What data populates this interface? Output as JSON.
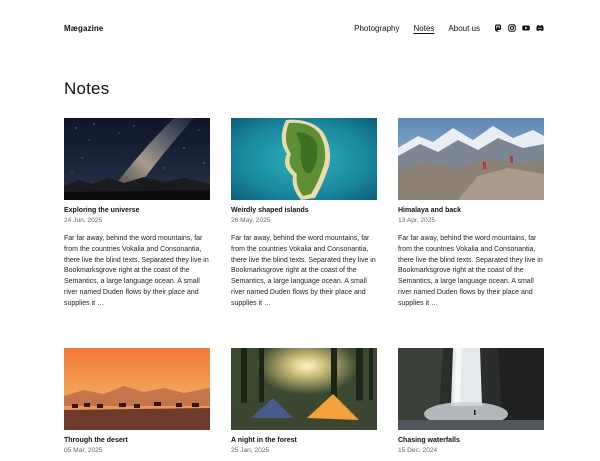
{
  "site": {
    "logo": "Mægazine"
  },
  "nav": {
    "items": [
      {
        "label": "Photography"
      },
      {
        "label": "Notes"
      },
      {
        "label": "About us"
      }
    ],
    "social_icons": [
      "mastodon-icon",
      "instagram-icon",
      "youtube-icon",
      "discord-icon"
    ]
  },
  "page": {
    "title": "Notes"
  },
  "posts": [
    {
      "title": "Exploring the universe",
      "date": "24 Jun, 2025",
      "excerpt": "Far far away, behind the word mountains, far from the countries Vokalia and Consonantia, there live the blind texts. Separated they live in Bookmarksgrove right at the coast of the Semantics, a large language ocean. A small river named Duden flows by their place and supplies it …",
      "image": "milky-way-night-sky"
    },
    {
      "title": "Weirdly shaped islands",
      "date": "26 May, 2025",
      "excerpt": "Far far away, behind the word mountains, far from the countries Vokalia and Consonantia, there live the blind texts. Separated they live in Bookmarksgrove right at the coast of the Semantics, a large language ocean. A small river named Duden flows by their place and supplies it …",
      "image": "aerial-island"
    },
    {
      "title": "Himalaya and back",
      "date": "13 Apr, 2025",
      "excerpt": "Far far away, behind the word mountains, far from the countries Vokalia and Consonantia, there live the blind texts. Separated they live in Bookmarksgrove right at the coast of the Semantics, a large language ocean. A small river named Duden flows by their place and supplies it …",
      "image": "himalaya-mountains"
    },
    {
      "title": "Through the desert",
      "date": "05 Mar, 2025",
      "excerpt": "",
      "image": "desert-camels-sunset"
    },
    {
      "title": "A night in the forest",
      "date": "25 Jan, 2025",
      "excerpt": "",
      "image": "forest-tents"
    },
    {
      "title": "Chasing waterfalls",
      "date": "15 Dec, 2024",
      "excerpt": "",
      "image": "waterfall"
    }
  ]
}
